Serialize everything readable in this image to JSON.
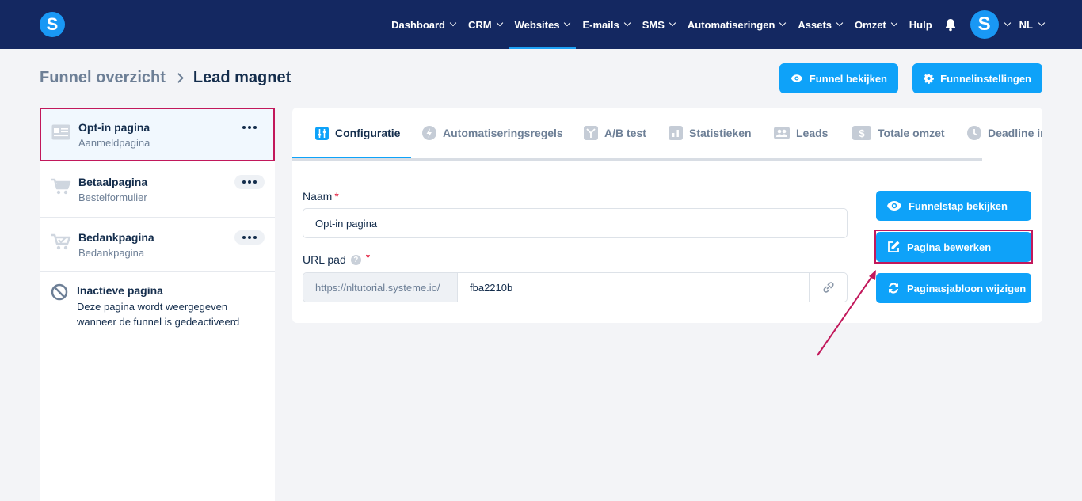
{
  "nav": {
    "logo_letter": "S",
    "items": [
      {
        "label": "Dashboard",
        "has_dropdown": true
      },
      {
        "label": "CRM",
        "has_dropdown": true
      },
      {
        "label": "Websites",
        "has_dropdown": true,
        "active": true
      },
      {
        "label": "E-mails",
        "has_dropdown": true
      },
      {
        "label": "SMS",
        "has_dropdown": true
      },
      {
        "label": "Automatiseringen",
        "has_dropdown": true
      },
      {
        "label": "Assets",
        "has_dropdown": true
      },
      {
        "label": "Omzet",
        "has_dropdown": true
      },
      {
        "label": "Hulp",
        "has_dropdown": false
      }
    ],
    "avatar_letter": "S",
    "language": "NL"
  },
  "breadcrumb": {
    "parent": "Funnel overzicht",
    "current": "Lead magnet"
  },
  "header_buttons": {
    "view_funnel": "Funnel bekijken",
    "funnel_settings": "Funnelinstellingen"
  },
  "sidebar": {
    "steps": [
      {
        "title": "Opt-in pagina",
        "subtitle": "Aanmeldpagina",
        "icon": "optin-page-icon",
        "active": true
      },
      {
        "title": "Betaalpagina",
        "subtitle": "Bestelformulier",
        "icon": "cart-icon"
      },
      {
        "title": "Bedankpagina",
        "subtitle": "Bedankpagina",
        "icon": "cart-check-icon"
      }
    ],
    "inactive": {
      "title": "Inactieve pagina",
      "text": "Deze pagina wordt weergegeven wanneer de funnel is gedeactiveerd",
      "icon": "ban-icon"
    }
  },
  "tabs": [
    {
      "label": "Configuratie",
      "icon": "sliders-icon",
      "active": true
    },
    {
      "label": "Automatiseringsregels",
      "icon": "bolt-icon"
    },
    {
      "label": "A/B test",
      "icon": "split-icon"
    },
    {
      "label": "Statistieken",
      "icon": "bar-chart-icon"
    },
    {
      "label": "Leads",
      "icon": "users-icon"
    },
    {
      "label": "Totale omzet",
      "icon": "dollar-icon"
    },
    {
      "label": "Deadline in",
      "icon": "clock-icon"
    }
  ],
  "form": {
    "name_label": "Naam",
    "name_value": "Opt-in pagina",
    "url_label": "URL pad",
    "url_prefix": "https://nltutorial.systeme.io/",
    "url_value": "fba2210b"
  },
  "actions": {
    "view_step": "Funnelstap bekijken",
    "edit_page": "Pagina bewerken",
    "change_template": "Paginasjabloon wijzigen"
  },
  "colors": {
    "nav_bg": "#142861",
    "accent": "#0ea2f9",
    "highlight": "#c2185b"
  }
}
